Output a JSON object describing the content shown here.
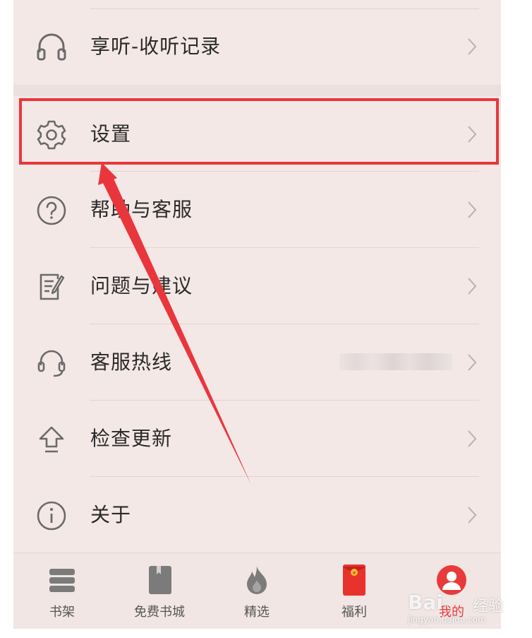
{
  "menu_top": [
    {
      "label": "享听-收听记录",
      "icon": "headphones-icon"
    }
  ],
  "menu_main": [
    {
      "label": "设置",
      "icon": "gear-icon"
    },
    {
      "label": "帮助与客服",
      "icon": "question-circle-icon"
    },
    {
      "label": "问题与建议",
      "icon": "feedback-edit-icon"
    },
    {
      "label": "客服热线",
      "icon": "headset-icon",
      "value_blurred": true
    },
    {
      "label": "检查更新",
      "icon": "upload-arrow-icon"
    },
    {
      "label": "关于",
      "icon": "info-circle-icon"
    }
  ],
  "tabs": [
    {
      "label": "书架",
      "icon": "bookshelf-icon"
    },
    {
      "label": "免费书城",
      "icon": "book-icon"
    },
    {
      "label": "精选",
      "icon": "flame-icon"
    },
    {
      "label": "福利",
      "icon": "red-envelope-icon"
    },
    {
      "label": "我的",
      "icon": "profile-icon",
      "active": true
    }
  ],
  "watermark": {
    "logo": "Bai",
    "brand": "经验",
    "url": "jingyan.baidu.com"
  },
  "colors": {
    "accent": "#e9363c",
    "background": "#f4e8e6",
    "text": "#2a2a2a",
    "icon": "#6a6a6a"
  }
}
